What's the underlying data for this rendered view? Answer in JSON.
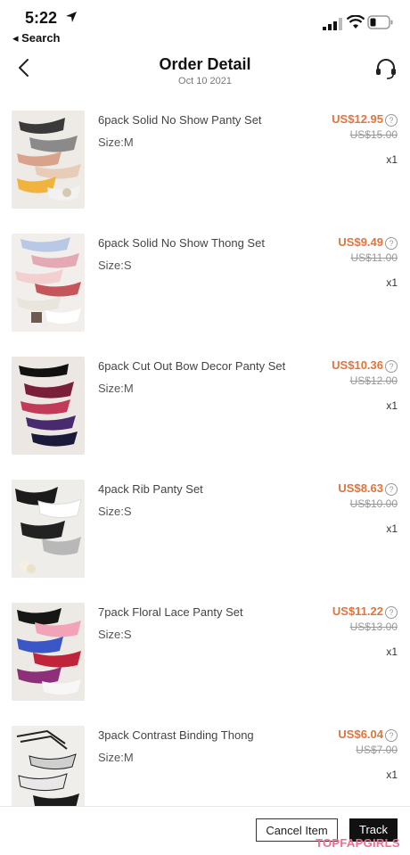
{
  "status_bar": {
    "time": "5:22",
    "back_app": "◂ Search"
  },
  "header": {
    "title": "Order Detail",
    "date": "Oct 10 2021"
  },
  "items": [
    {
      "name": "6pack Solid No Show Panty Set",
      "size": "Size:M",
      "price": "US$12.95",
      "original_price": "US$15.00",
      "qty": "x1"
    },
    {
      "name": "6pack Solid No Show Thong Set",
      "size": "Size:S",
      "price": "US$9.49",
      "original_price": "US$11.00",
      "qty": "x1"
    },
    {
      "name": "6pack Cut Out Bow Decor Panty Set",
      "size": "Size:M",
      "price": "US$10.36",
      "original_price": "US$12.00",
      "qty": "x1"
    },
    {
      "name": "4pack Rib Panty Set",
      "size": "Size:S",
      "price": "US$8.63",
      "original_price": "US$10.00",
      "qty": "x1"
    },
    {
      "name": "7pack Floral Lace Panty Set",
      "size": "Size:S",
      "price": "US$11.22",
      "original_price": "US$13.00",
      "qty": "x1"
    },
    {
      "name": "3pack Contrast Binding Thong",
      "size": "Size:M",
      "price": "US$6.04",
      "original_price": "US$7.00",
      "qty": "x1"
    }
  ],
  "actions": {
    "cancel_label": "Cancel Item",
    "track_label": "Track"
  },
  "watermark": "TOPFAPGIRLS",
  "colors": {
    "price": "#e0743c",
    "strike": "#999999",
    "track_bg": "#111111",
    "watermark": "#f06b8c"
  }
}
